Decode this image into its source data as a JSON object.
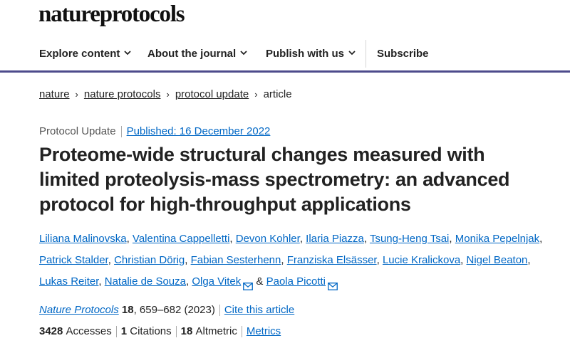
{
  "site": {
    "logo": "natureprotocols"
  },
  "nav": {
    "items": [
      {
        "label": "Explore content"
      },
      {
        "label": "About the journal"
      },
      {
        "label": "Publish with us"
      }
    ],
    "subscribe": "Subscribe"
  },
  "breadcrumb": [
    "nature",
    "nature protocols",
    "protocol update",
    "article"
  ],
  "article": {
    "type": "Protocol Update",
    "published": "Published: 16 December 2022",
    "title": "Proteome-wide structural changes measured with limited proteolysis-mass spectrometry: an advanced protocol for high-throughput applications",
    "authors": [
      "Liliana Malinovska",
      "Valentina Cappelletti",
      "Devon Kohler",
      "Ilaria Piazza",
      "Tsung-Heng Tsai",
      "Monika Pepelnjak",
      "Patrick Stalder",
      "Christian Dörig",
      "Fabian Sesterhenn",
      "Franziska Elsässer",
      "Lucie Kralickova",
      "Nigel Beaton",
      "Lukas Reiter",
      "Natalie de Souza",
      "Olga Vitek",
      "Paola Picotti"
    ],
    "author_sep": ", ",
    "author_and": " & ",
    "journal_name": "Nature Protocols",
    "volume": "18",
    "pages_year": ", 659–682 (2023)",
    "cite": "Cite this article"
  },
  "metrics": {
    "accesses_value": "3428",
    "accesses_label": "Accesses",
    "citations_value": "1",
    "citations_label": "Citations",
    "altmetric_value": "18",
    "altmetric_label": "Altmetric",
    "metrics_link": "Metrics"
  },
  "colors": {
    "link": "#0067c5",
    "nav_border": "#4d4b8c",
    "text": "#222222",
    "muted": "#555555"
  }
}
